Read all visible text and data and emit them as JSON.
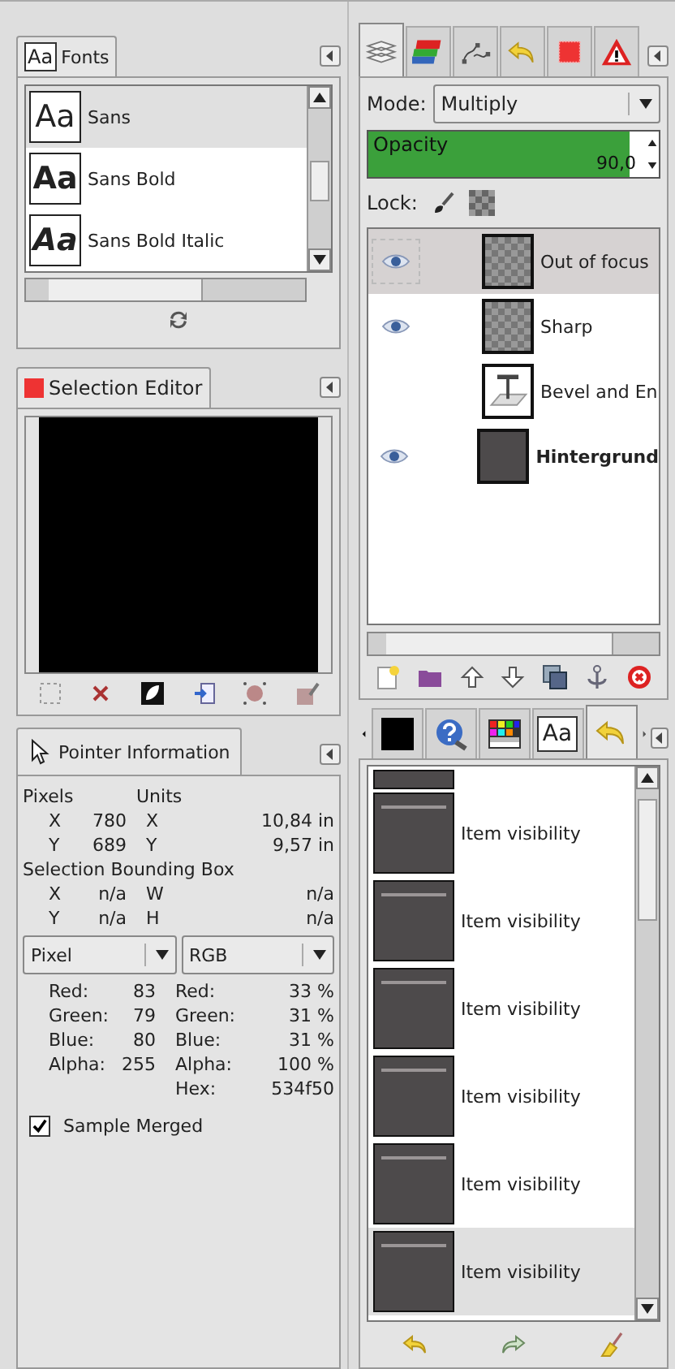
{
  "fonts_dock": {
    "tab_icon": "Aa",
    "tab": "Fonts",
    "fonts": [
      {
        "preview": "Aa",
        "name": "Sans",
        "selected": true
      },
      {
        "preview": "Aa",
        "name": "Sans Bold",
        "selected": false
      },
      {
        "preview": "Aa",
        "name": "Sans Bold Italic",
        "selected": false
      }
    ]
  },
  "selection_editor": {
    "tab": "Selection Editor"
  },
  "pointer_info": {
    "tab": "Pointer Information",
    "pixels_heading": "Pixels",
    "units_heading": "Units",
    "position_rows": [
      {
        "axis": "X",
        "pixels": "780",
        "unit_axis": "X",
        "units": "10,84 in"
      },
      {
        "axis": "Y",
        "pixels": "689",
        "unit_axis": "Y",
        "units": "9,57 in"
      }
    ],
    "bbox_heading": "Selection Bounding Box",
    "bbox_rows": [
      {
        "axis": "X",
        "value": "n/a",
        "size_axis": "W",
        "size": "n/a"
      },
      {
        "axis": "Y",
        "value": "n/a",
        "size_axis": "H",
        "size": "n/a"
      }
    ],
    "left_mode": "Pixel",
    "right_mode": "RGB",
    "left_values": [
      {
        "label": "Red:",
        "value": "83"
      },
      {
        "label": "Green:",
        "value": "79"
      },
      {
        "label": "Blue:",
        "value": "80"
      },
      {
        "label": "Alpha:",
        "value": "255"
      }
    ],
    "right_values": [
      {
        "label": "Red:",
        "value": "33 %"
      },
      {
        "label": "Green:",
        "value": "31 %"
      },
      {
        "label": "Blue:",
        "value": "31 %"
      },
      {
        "label": "Alpha:",
        "value": "100 %"
      },
      {
        "label": "Hex:",
        "value": "534f50"
      }
    ],
    "sample_merged": {
      "label": "Sample Merged",
      "checked": true
    }
  },
  "layers_dock": {
    "tabs": [
      {
        "kind": "layers",
        "selected": true
      },
      {
        "kind": "channels",
        "selected": false
      },
      {
        "kind": "paths",
        "selected": false
      },
      {
        "kind": "undo",
        "selected": false
      },
      {
        "kind": "selection",
        "selected": false
      },
      {
        "kind": "warning",
        "selected": false
      }
    ],
    "mode_label": "Mode:",
    "mode": "Multiply",
    "opacity": {
      "label": "Opacity",
      "value": "90,0",
      "level": 0.9
    },
    "lock_label": "Lock:",
    "layers": [
      {
        "name": "Out of focus",
        "visible": true,
        "selected": true,
        "kind": "checker",
        "bold": false
      },
      {
        "name": "Sharp",
        "visible": true,
        "selected": false,
        "kind": "checker",
        "bold": false
      },
      {
        "name": "Bevel and En",
        "visible": false,
        "selected": false,
        "kind": "text",
        "bold": false
      },
      {
        "name": "Hintergrund",
        "visible": true,
        "selected": false,
        "kind": "dark",
        "bold": true
      }
    ]
  },
  "undo_dock": {
    "tabs": [
      {
        "kind": "color",
        "selected": false
      },
      {
        "kind": "help",
        "selected": false
      },
      {
        "kind": "palette",
        "selected": false
      },
      {
        "kind": "font",
        "text": "Aa",
        "selected": false
      },
      {
        "kind": "undo",
        "selected": true
      }
    ],
    "items": [
      {
        "selected": false
      },
      {
        "label": "Item visibility",
        "selected": false
      },
      {
        "label": "Item visibility",
        "selected": false
      },
      {
        "label": "Item visibility",
        "selected": false
      },
      {
        "label": "Item visibility",
        "selected": false
      },
      {
        "label": "Item visibility",
        "selected": false
      },
      {
        "label": "Item visibility",
        "selected": true
      }
    ]
  }
}
